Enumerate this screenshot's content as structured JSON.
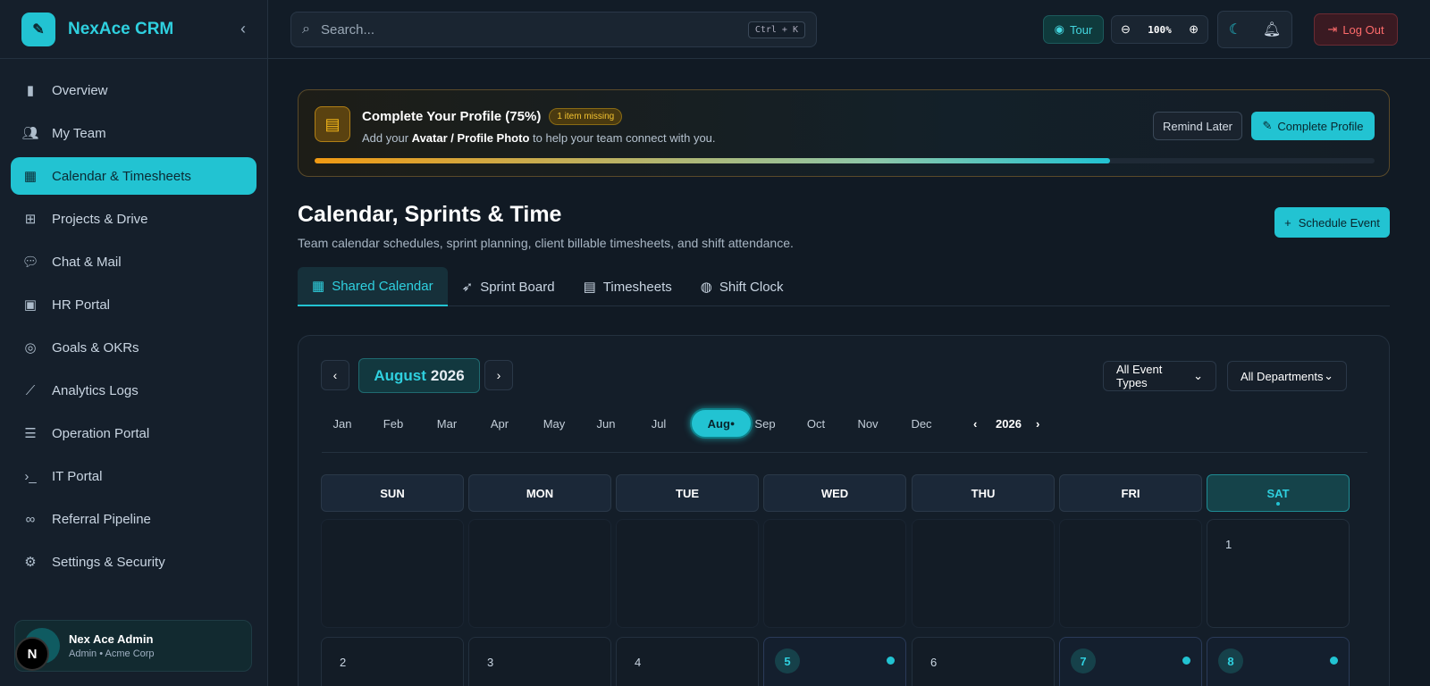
{
  "brand": {
    "name": "NexAce CRM",
    "logo_icon": "magic-wand-icon"
  },
  "sidebar": {
    "items": [
      {
        "label": "Overview",
        "icon": "bar-chart-icon"
      },
      {
        "label": "My Team",
        "icon": "users-icon"
      },
      {
        "label": "Calendar & Timesheets",
        "icon": "calendar-icon",
        "active": true
      },
      {
        "label": "Projects & Drive",
        "icon": "folder-tree-icon"
      },
      {
        "label": "Chat & Mail",
        "icon": "chat-icon"
      },
      {
        "label": "HR Portal",
        "icon": "briefcase-icon"
      },
      {
        "label": "Goals & OKRs",
        "icon": "target-icon"
      },
      {
        "label": "Analytics Logs",
        "icon": "line-chart-icon"
      },
      {
        "label": "Operation Portal",
        "icon": "list-check-icon"
      },
      {
        "label": "IT Portal",
        "icon": "terminal-icon"
      },
      {
        "label": "Referral Pipeline",
        "icon": "link-icon"
      },
      {
        "label": "Settings & Security",
        "icon": "gear-icon"
      }
    ]
  },
  "user": {
    "name": "Nex Ace Admin",
    "role": "Admin • Acme Corp",
    "badge": "N"
  },
  "topbar": {
    "search_placeholder": "Search...",
    "shortcut": "Ctrl + K",
    "tour_label": "Tour",
    "zoom": "100%",
    "logout_label": "Log Out"
  },
  "banner": {
    "title": "Complete Your Profile (75%)",
    "badge": "1 item missing",
    "sub_prefix": "Add your",
    "sub_bold": "Avatar / Profile Photo",
    "sub_suffix": "to help your team connect with you.",
    "progress": 0.75,
    "remind_label": "Remind Later",
    "complete_label": "Complete Profile"
  },
  "page": {
    "title": "Calendar, Sprints & Time",
    "subtitle": "Team calendar schedules, sprint planning, client billable timesheets, and shift attendance.",
    "schedule_label": "Schedule Event"
  },
  "tabs": [
    {
      "label": "Shared Calendar",
      "icon": "calendar-icon",
      "active": true
    },
    {
      "label": "Sprint Board",
      "icon": "rocket-icon"
    },
    {
      "label": "Timesheets",
      "icon": "csv-file-icon"
    },
    {
      "label": "Shift Clock",
      "icon": "fingerprint-icon"
    }
  ],
  "calendar": {
    "month": "August",
    "year": "2026",
    "filters": [
      "All Event Types",
      "All Departments"
    ],
    "months": [
      "Jan",
      "Feb",
      "Mar",
      "Apr",
      "May",
      "Jun",
      "Jul",
      "Aug",
      "Sep",
      "Oct",
      "Nov",
      "Dec"
    ],
    "active_month": "Aug",
    "year_nav": "2026",
    "weekdays": [
      "SUN",
      "MON",
      "TUE",
      "WED",
      "THU",
      "FRI",
      "SAT"
    ],
    "week1": [
      "",
      "",
      "",
      "",
      "",
      "",
      "1"
    ],
    "week2": [
      {
        "day": "2",
        "event": false
      },
      {
        "day": "3",
        "event": false
      },
      {
        "day": "4",
        "event": false
      },
      {
        "day": "5",
        "event": true
      },
      {
        "day": "6",
        "event": false
      },
      {
        "day": "7",
        "event": true
      },
      {
        "day": "8",
        "event": true
      }
    ]
  },
  "colors": {
    "accent": "#22c3d2",
    "warning": "#f2b619",
    "danger": "#ff6b6b"
  }
}
